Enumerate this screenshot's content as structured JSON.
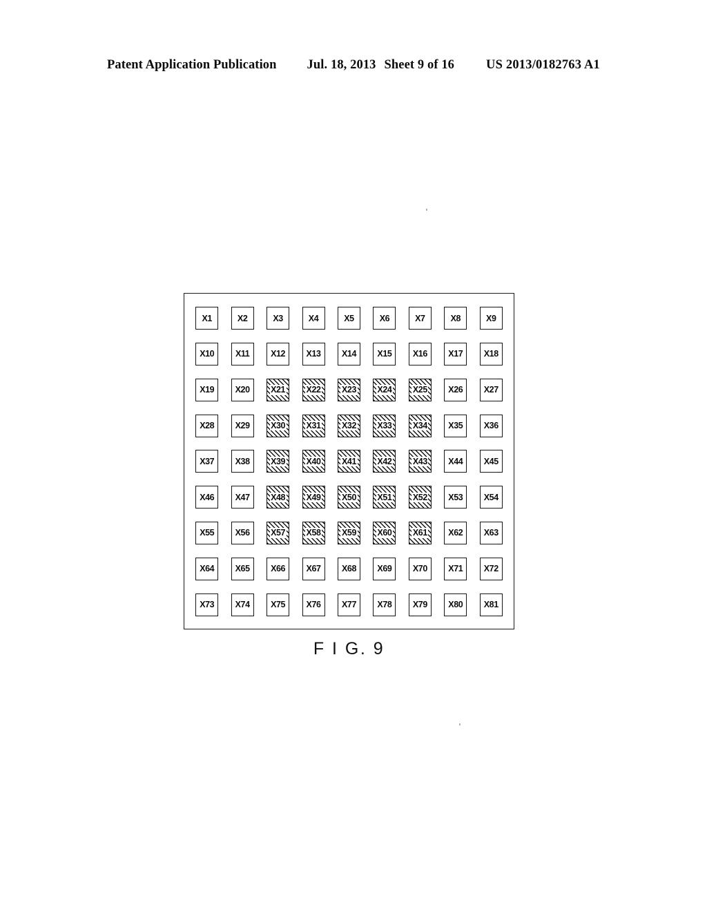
{
  "header": {
    "publication": "Patent Application Publication",
    "date": "Jul. 18, 2013",
    "sheet": "Sheet 9 of 16",
    "patent_number": "US 2013/0182763 A1"
  },
  "figure": {
    "caption": "F I G. 9",
    "rows": 9,
    "columns": 9,
    "hatch_angle_deg": 45,
    "colors": {
      "ink": "#141414",
      "paper": "#ffffff"
    },
    "cells": [
      {
        "label": "X1",
        "hatched": false
      },
      {
        "label": "X2",
        "hatched": false
      },
      {
        "label": "X3",
        "hatched": false
      },
      {
        "label": "X4",
        "hatched": false
      },
      {
        "label": "X5",
        "hatched": false
      },
      {
        "label": "X6",
        "hatched": false
      },
      {
        "label": "X7",
        "hatched": false
      },
      {
        "label": "X8",
        "hatched": false
      },
      {
        "label": "X9",
        "hatched": false
      },
      {
        "label": "X10",
        "hatched": false
      },
      {
        "label": "X11",
        "hatched": false
      },
      {
        "label": "X12",
        "hatched": false
      },
      {
        "label": "X13",
        "hatched": false
      },
      {
        "label": "X14",
        "hatched": false
      },
      {
        "label": "X15",
        "hatched": false
      },
      {
        "label": "X16",
        "hatched": false
      },
      {
        "label": "X17",
        "hatched": false
      },
      {
        "label": "X18",
        "hatched": false
      },
      {
        "label": "X19",
        "hatched": false
      },
      {
        "label": "X20",
        "hatched": false
      },
      {
        "label": "X21",
        "hatched": true
      },
      {
        "label": "X22",
        "hatched": true
      },
      {
        "label": "X23",
        "hatched": true
      },
      {
        "label": "X24",
        "hatched": true
      },
      {
        "label": "X25",
        "hatched": true
      },
      {
        "label": "X26",
        "hatched": false
      },
      {
        "label": "X27",
        "hatched": false
      },
      {
        "label": "X28",
        "hatched": false
      },
      {
        "label": "X29",
        "hatched": false
      },
      {
        "label": "X30",
        "hatched": true
      },
      {
        "label": "X31",
        "hatched": true
      },
      {
        "label": "X32",
        "hatched": true
      },
      {
        "label": "X33",
        "hatched": true
      },
      {
        "label": "X34",
        "hatched": true
      },
      {
        "label": "X35",
        "hatched": false
      },
      {
        "label": "X36",
        "hatched": false
      },
      {
        "label": "X37",
        "hatched": false
      },
      {
        "label": "X38",
        "hatched": false
      },
      {
        "label": "X39",
        "hatched": true
      },
      {
        "label": "X40",
        "hatched": true
      },
      {
        "label": "X41",
        "hatched": true
      },
      {
        "label": "X42",
        "hatched": true
      },
      {
        "label": "X43",
        "hatched": true
      },
      {
        "label": "X44",
        "hatched": false
      },
      {
        "label": "X45",
        "hatched": false
      },
      {
        "label": "X46",
        "hatched": false
      },
      {
        "label": "X47",
        "hatched": false
      },
      {
        "label": "X48",
        "hatched": true
      },
      {
        "label": "X49",
        "hatched": true
      },
      {
        "label": "X50",
        "hatched": true
      },
      {
        "label": "X51",
        "hatched": true
      },
      {
        "label": "X52",
        "hatched": true
      },
      {
        "label": "X53",
        "hatched": false
      },
      {
        "label": "X54",
        "hatched": false
      },
      {
        "label": "X55",
        "hatched": false
      },
      {
        "label": "X56",
        "hatched": false
      },
      {
        "label": "X57",
        "hatched": true
      },
      {
        "label": "X58",
        "hatched": true
      },
      {
        "label": "X59",
        "hatched": true
      },
      {
        "label": "X60",
        "hatched": true
      },
      {
        "label": "X61",
        "hatched": true
      },
      {
        "label": "X62",
        "hatched": false
      },
      {
        "label": "X63",
        "hatched": false
      },
      {
        "label": "X64",
        "hatched": false
      },
      {
        "label": "X65",
        "hatched": false
      },
      {
        "label": "X66",
        "hatched": false
      },
      {
        "label": "X67",
        "hatched": false
      },
      {
        "label": "X68",
        "hatched": false
      },
      {
        "label": "X69",
        "hatched": false
      },
      {
        "label": "X70",
        "hatched": false
      },
      {
        "label": "X71",
        "hatched": false
      },
      {
        "label": "X72",
        "hatched": false
      },
      {
        "label": "X73",
        "hatched": false
      },
      {
        "label": "X74",
        "hatched": false
      },
      {
        "label": "X75",
        "hatched": false
      },
      {
        "label": "X76",
        "hatched": false
      },
      {
        "label": "X77",
        "hatched": false
      },
      {
        "label": "X78",
        "hatched": false
      },
      {
        "label": "X79",
        "hatched": false
      },
      {
        "label": "X80",
        "hatched": false
      },
      {
        "label": "X81",
        "hatched": false
      }
    ]
  }
}
